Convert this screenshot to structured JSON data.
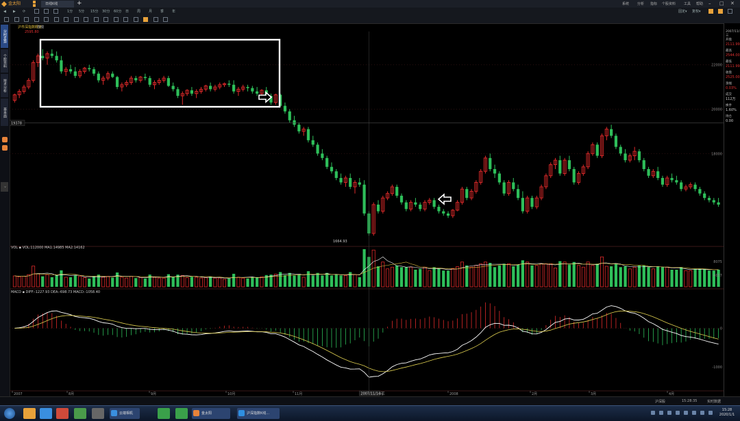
{
  "app": {
    "logo_text": "金太阳",
    "tab_title": "日线K线"
  },
  "title_menu": [
    "系统",
    "分析",
    "指标",
    "个股资料",
    "工具",
    "帮助"
  ],
  "toolbar1": {
    "periods": [
      "1分",
      "5分",
      "15分",
      "30分",
      "60分",
      "日",
      "周",
      "月",
      "季",
      "年"
    ],
    "right_items": [
      "固定▾",
      "复权▾"
    ]
  },
  "sidebar_tabs": [
    "分时走势",
    "个股资料",
    "技术分析",
    "基本面"
  ],
  "chart_labels": {
    "indicator_title": "沪市深指数概览",
    "period_label": "日线",
    "high_mark": "2595.80",
    "crosshair_price": "19378",
    "low_mark": "1664.93",
    "vol_text": "VOL ▪ VOL:112000  MA1:14985  MA2:14162",
    "macd_text": "MACD ▪ DIFF:-1227.93  DEA:-698.73  MACD:-1058.40",
    "crosshair_date": "2007/11/14 三",
    "time_axis": [
      "2007",
      "8月",
      "9月",
      "10月",
      "11月",
      "12月",
      "2008",
      "2月",
      "3月",
      "4月"
    ],
    "price_axis": [
      "22000",
      "20000",
      "18000"
    ],
    "vol_axis": [
      "8075",
      "4037"
    ],
    "macd_axis": [
      "0",
      "-1000"
    ]
  },
  "right_panel": [
    {
      "label": "开盘",
      "value": "2111.99",
      "tone": "r"
    },
    {
      "label": "最高",
      "value": "2544.00",
      "tone": "r"
    },
    {
      "label": "最低",
      "value": "2111.99",
      "tone": "r"
    },
    {
      "label": "收盘",
      "value": "2525.00",
      "tone": "r"
    },
    {
      "label": "涨幅",
      "value": "0.03%",
      "tone": "r"
    },
    {
      "label": "成交",
      "value": "112万",
      "tone": "w"
    },
    {
      "label": "换手",
      "value": "1.60%",
      "tone": "w"
    },
    {
      "label": "持仓",
      "value": "0.00",
      "tone": "w"
    }
  ],
  "statusbar": {
    "left": "",
    "right_items": [
      "沪深股",
      "15:28:35",
      "实时数据"
    ]
  },
  "taskbar": {
    "windows": [
      {
        "label": "金太阳",
        "color": "#e8833a"
      },
      {
        "label": "云端相机",
        "color": "#2f8fe0"
      },
      {
        "label": "沪深指数K线...",
        "color": "#2f8fe0"
      }
    ],
    "time": "15:28",
    "date": "2020/1/1"
  },
  "colors": {
    "up": "#e02a2a",
    "down": "#2ebf5a",
    "bg": "#000000",
    "accent": "#e8a23a"
  },
  "chart_data": {
    "type": "candlestick",
    "title": "",
    "series_note": "daily candles with VOL and MACD sub-panels",
    "candles": [
      [
        20400,
        20700,
        20300,
        20650
      ],
      [
        20650,
        20900,
        20500,
        20800
      ],
      [
        20800,
        21100,
        20700,
        21000
      ],
      [
        21000,
        21400,
        20900,
        21300
      ],
      [
        21300,
        22200,
        21200,
        22100
      ],
      [
        22100,
        22500,
        21900,
        22400
      ],
      [
        22400,
        22700,
        22200,
        22300
      ],
      [
        22300,
        22600,
        22000,
        22500
      ],
      [
        22500,
        22700,
        22300,
        22400
      ],
      [
        22400,
        22600,
        22100,
        22200
      ],
      [
        22200,
        22400,
        21600,
        21700
      ],
      [
        21700,
        21900,
        21500,
        21800
      ],
      [
        21800,
        22000,
        21600,
        21700
      ],
      [
        21700,
        21900,
        21400,
        21500
      ],
      [
        21500,
        21800,
        21400,
        21700
      ],
      [
        21700,
        21900,
        21600,
        21850
      ],
      [
        21850,
        22000,
        21700,
        21800
      ],
      [
        21800,
        21900,
        21500,
        21600
      ],
      [
        21600,
        21700,
        21200,
        21300
      ],
      [
        21300,
        21500,
        21100,
        21400
      ],
      [
        21400,
        21700,
        21300,
        21600
      ],
      [
        21600,
        21700,
        21400,
        21450
      ],
      [
        21450,
        21500,
        20900,
        21000
      ],
      [
        21000,
        21200,
        20800,
        21100
      ],
      [
        21100,
        21300,
        21000,
        21200
      ],
      [
        21200,
        21500,
        21100,
        21400
      ],
      [
        21400,
        21500,
        21200,
        21300
      ],
      [
        21300,
        21500,
        21200,
        21450
      ],
      [
        21450,
        21600,
        21300,
        21400
      ],
      [
        21400,
        21500,
        21000,
        21100
      ],
      [
        21100,
        21300,
        20900,
        21200
      ],
      [
        21200,
        21400,
        21100,
        21300
      ],
      [
        21300,
        21500,
        21200,
        21400
      ],
      [
        21400,
        21500,
        21000,
        21050
      ],
      [
        21050,
        21200,
        20800,
        20900
      ],
      [
        20900,
        21000,
        20500,
        20600
      ],
      [
        20600,
        20800,
        20200,
        20700
      ],
      [
        20700,
        20900,
        20600,
        20850
      ],
      [
        20850,
        21000,
        20600,
        20700
      ],
      [
        20700,
        20900,
        20500,
        20800
      ],
      [
        20800,
        21000,
        20700,
        20900
      ],
      [
        20900,
        21100,
        20800,
        21050
      ],
      [
        21050,
        21200,
        20800,
        20900
      ],
      [
        20900,
        21100,
        20800,
        21000
      ],
      [
        21000,
        21200,
        20900,
        21100
      ],
      [
        21100,
        21200,
        21000,
        21150
      ],
      [
        21150,
        21300,
        21000,
        21100
      ],
      [
        21100,
        21300,
        20700,
        20800
      ],
      [
        20800,
        21000,
        20600,
        20900
      ],
      [
        20900,
        21100,
        20800,
        21000
      ],
      [
        21000,
        21100,
        20800,
        20950
      ],
      [
        20950,
        21050,
        20700,
        20800
      ],
      [
        20800,
        21000,
        20600,
        20700
      ],
      [
        20700,
        20900,
        20500,
        20850
      ],
      [
        20850,
        21000,
        20500,
        20600
      ],
      [
        20600,
        20700,
        20200,
        20300
      ],
      [
        20300,
        20700,
        20200,
        20650
      ],
      [
        20650,
        20700,
        20100,
        20150
      ],
      [
        20150,
        20300,
        19800,
        19900
      ],
      [
        19900,
        20000,
        19400,
        19500
      ],
      [
        19500,
        19700,
        19200,
        19300
      ],
      [
        19300,
        19400,
        18900,
        19000
      ],
      [
        19000,
        19200,
        18800,
        19100
      ],
      [
        19100,
        19200,
        18500,
        18600
      ],
      [
        18600,
        18800,
        18300,
        18400
      ],
      [
        18400,
        18500,
        17900,
        18000
      ],
      [
        18000,
        18200,
        17700,
        17800
      ],
      [
        17800,
        17900,
        17300,
        17400
      ],
      [
        17400,
        17600,
        17100,
        17200
      ],
      [
        17200,
        17300,
        16800,
        16900
      ],
      [
        16900,
        17100,
        16600,
        16700
      ],
      [
        16700,
        17000,
        16500,
        16900
      ],
      [
        16900,
        17100,
        16400,
        16500
      ],
      [
        16500,
        16800,
        16200,
        16700
      ],
      [
        16700,
        16900,
        16500,
        16600
      ],
      [
        16600,
        16800,
        15200,
        15300
      ],
      [
        15300,
        15400,
        14300,
        14400
      ],
      [
        14400,
        15800,
        14300,
        15700
      ],
      [
        15700,
        15900,
        15300,
        15400
      ],
      [
        15400,
        16100,
        15300,
        16000
      ],
      [
        16000,
        16300,
        15900,
        16200
      ],
      [
        16200,
        16600,
        16100,
        16500
      ],
      [
        16500,
        16600,
        16000,
        16100
      ],
      [
        16100,
        16200,
        15700,
        15800
      ],
      [
        15800,
        15900,
        15400,
        15500
      ],
      [
        15500,
        15900,
        15400,
        15800
      ],
      [
        15800,
        16000,
        15600,
        15700
      ],
      [
        15700,
        15800,
        15400,
        15500
      ],
      [
        15500,
        15900,
        15400,
        15800
      ],
      [
        15800,
        16000,
        15700,
        15900
      ],
      [
        15900,
        16000,
        15500,
        15600
      ],
      [
        15600,
        15700,
        15300,
        15400
      ],
      [
        15400,
        15500,
        15200,
        15300
      ],
      [
        15300,
        15400,
        15100,
        15200
      ],
      [
        15200,
        15500,
        15100,
        15450
      ],
      [
        15450,
        15900,
        15400,
        15800
      ],
      [
        15800,
        16500,
        15700,
        16400
      ],
      [
        16400,
        16500,
        15900,
        16000
      ],
      [
        16000,
        16400,
        15900,
        16300
      ],
      [
        16300,
        16800,
        16200,
        16700
      ],
      [
        16700,
        17300,
        16600,
        17200
      ],
      [
        17200,
        17900,
        17100,
        17800
      ],
      [
        17800,
        18000,
        17200,
        17300
      ],
      [
        17300,
        17500,
        16900,
        17100
      ],
      [
        17100,
        17200,
        16600,
        16700
      ],
      [
        16700,
        16800,
        16100,
        16200
      ],
      [
        16200,
        16800,
        16100,
        16700
      ],
      [
        16700,
        16900,
        16300,
        16400
      ],
      [
        16400,
        16600,
        15900,
        16000
      ],
      [
        16000,
        16300,
        15300,
        15400
      ],
      [
        15400,
        16100,
        15300,
        16000
      ],
      [
        16000,
        16100,
        15500,
        15600
      ],
      [
        15600,
        16100,
        15500,
        16000
      ],
      [
        16000,
        16600,
        15900,
        16500
      ],
      [
        16500,
        17100,
        16400,
        17000
      ],
      [
        17000,
        17600,
        16900,
        17500
      ],
      [
        17500,
        17800,
        17300,
        17700
      ],
      [
        17700,
        17900,
        17000,
        17100
      ],
      [
        17100,
        17800,
        17000,
        17700
      ],
      [
        17700,
        17900,
        17200,
        17300
      ],
      [
        17300,
        17400,
        16600,
        16700
      ],
      [
        16700,
        17200,
        16600,
        17100
      ],
      [
        17100,
        17500,
        17000,
        17400
      ],
      [
        17400,
        18100,
        17300,
        18000
      ],
      [
        18000,
        18500,
        17900,
        18400
      ],
      [
        18400,
        18500,
        17800,
        17900
      ],
      [
        17900,
        18900,
        17800,
        18800
      ],
      [
        18800,
        19200,
        18600,
        19100
      ],
      [
        19100,
        19300,
        18700,
        18800
      ],
      [
        18800,
        18900,
        18200,
        18300
      ],
      [
        18300,
        18400,
        17900,
        18000
      ],
      [
        18000,
        18200,
        17600,
        17700
      ],
      [
        17700,
        18000,
        17600,
        17900
      ],
      [
        17900,
        18300,
        17700,
        18100
      ],
      [
        18100,
        18200,
        17600,
        17700
      ],
      [
        17700,
        17800,
        17200,
        17300
      ],
      [
        17300,
        17400,
        16900,
        17000
      ],
      [
        17000,
        17300,
        16900,
        17200
      ],
      [
        17200,
        17400,
        16800,
        16900
      ],
      [
        16900,
        17000,
        16500,
        16600
      ],
      [
        16600,
        17000,
        16500,
        16900
      ],
      [
        16900,
        17100,
        16700,
        16800
      ],
      [
        16800,
        17000,
        16600,
        16700
      ],
      [
        16700,
        16800,
        16300,
        16400
      ],
      [
        16400,
        16600,
        16300,
        16500
      ],
      [
        16500,
        16700,
        16400,
        16600
      ],
      [
        16600,
        16700,
        16300,
        16400
      ],
      [
        16400,
        16500,
        16100,
        16200
      ],
      [
        16200,
        16300,
        15900,
        16000
      ],
      [
        16000,
        16100,
        15800,
        15900
      ],
      [
        15900,
        16000,
        15700,
        15800
      ],
      [
        15800,
        16000,
        15600,
        15700
      ]
    ],
    "ylim": [
      14000,
      23500
    ]
  }
}
